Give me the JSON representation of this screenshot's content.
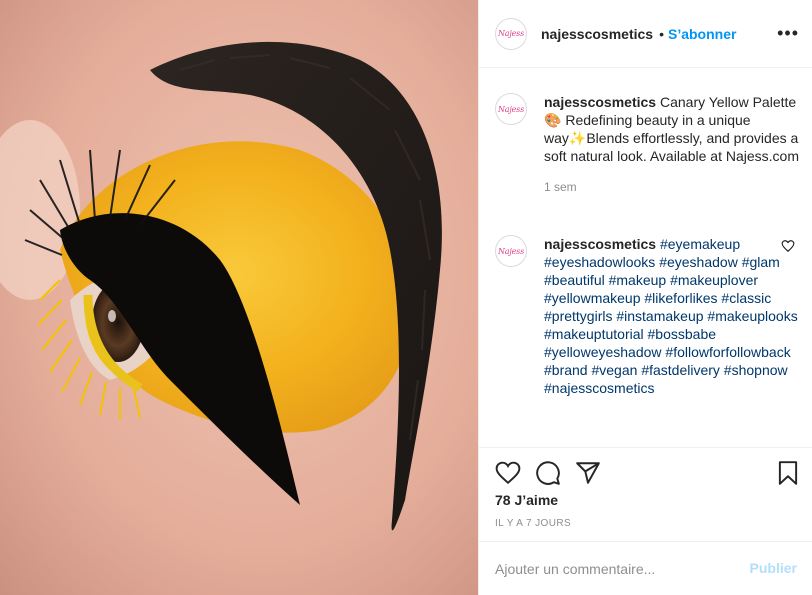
{
  "post": {
    "username": "najesscosmetics",
    "avatar_logo_text": "Najess",
    "follow_label": "S’abonner",
    "separator": "•",
    "more_label": "•••"
  },
  "caption": {
    "username": "najesscosmetics",
    "text_part1": "Canary Yellow Palette",
    "emoji_palette": "🎨",
    "text_part2": "Redefining beauty in a unique way",
    "emoji_sparkles": "✨",
    "text_part3": "Blends effortlessly, and provides a soft natural look. Available at Najess.com",
    "time": "1 sem"
  },
  "hashtag_comment": {
    "username": "najesscosmetics",
    "tags": [
      "#eyemakeup",
      "#eyeshadowlooks",
      "#eyeshadow",
      "#glam",
      "#beautiful",
      "#makeup",
      "#makeuplover",
      "#yellowmakeup",
      "#likeforlikes",
      "#classic",
      "#prettygirls",
      "#instamakeup",
      "#makeuplooks",
      "#makeuptutorial",
      "#bossbabe",
      "#yelloweyeshadow",
      "#followforfollowback",
      "#brand",
      "#vegan",
      "#fastdelivery",
      "#shopnow",
      "#najesscosmetics"
    ]
  },
  "actions": {
    "icons": [
      "heart-icon",
      "comment-icon",
      "share-icon",
      "bookmark-icon"
    ]
  },
  "likes_label": "78 J’aime",
  "posted_ago": "IL Y A 7 JOURS",
  "add_comment": {
    "placeholder": "Ajouter un commentaire...",
    "publish_label": "Publier"
  },
  "colors": {
    "link_blue": "#0095f6",
    "hashtag_blue": "#00376b",
    "publish_disabled": "#b2dffc",
    "eyeshadow_yellow": "#f4b21c"
  }
}
